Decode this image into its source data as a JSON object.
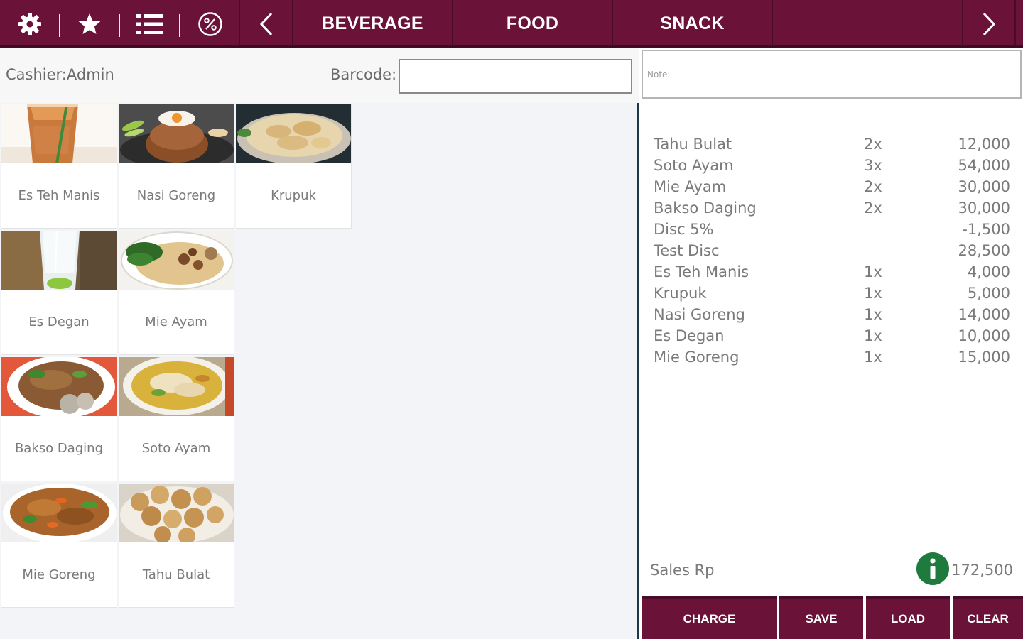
{
  "toolbar": {
    "icons": [
      "gear-icon",
      "star-icon",
      "list-icon",
      "discount-icon",
      "chevron-left-icon",
      "chevron-right-icon"
    ],
    "categories": [
      "BEVERAGE",
      "FOOD",
      "SNACK",
      ""
    ]
  },
  "header": {
    "cashier": "Cashier:Admin",
    "barcode_label": "Barcode:",
    "barcode_value": ""
  },
  "note": {
    "placeholder": "Note:"
  },
  "products": [
    {
      "name": "Es Teh Manis",
      "image": "iced-tea"
    },
    {
      "name": "Nasi Goreng",
      "image": "fried-rice"
    },
    {
      "name": "Krupuk",
      "image": "crackers"
    },
    {
      "name": "Es Degan",
      "image": "coconut-drink"
    },
    {
      "name": "Mie Ayam",
      "image": "chicken-noodle"
    },
    {
      "name": "Bakso Daging",
      "image": "meatball-soup"
    },
    {
      "name": "Soto Ayam",
      "image": "chicken-soup"
    },
    {
      "name": "Mie Goreng",
      "image": "fried-noodle"
    },
    {
      "name": "Tahu Bulat",
      "image": "round-tofu"
    }
  ],
  "order": {
    "items": [
      {
        "name": "Tahu Bulat",
        "qty": "2x",
        "amount": "12,000"
      },
      {
        "name": "Soto Ayam",
        "qty": "3x",
        "amount": "54,000"
      },
      {
        "name": "Mie Ayam",
        "qty": "2x",
        "amount": "30,000"
      },
      {
        "name": "Bakso Daging",
        "qty": "2x",
        "amount": "30,000"
      },
      {
        "name": "Disc 5%",
        "qty": "",
        "amount": "-1,500"
      },
      {
        "name": "Test Disc",
        "qty": "",
        "amount": "28,500"
      },
      {
        "name": "Es Teh Manis",
        "qty": "1x",
        "amount": "4,000"
      },
      {
        "name": "Krupuk",
        "qty": "1x",
        "amount": "5,000"
      },
      {
        "name": "Nasi Goreng",
        "qty": "1x",
        "amount": "14,000"
      },
      {
        "name": "Es Degan",
        "qty": "1x",
        "amount": "10,000"
      },
      {
        "name": "Mie Goreng",
        "qty": "1x",
        "amount": "15,000"
      }
    ],
    "sales_label": "Sales Rp",
    "sales_total": "172,500"
  },
  "actions": {
    "charge": "CHARGE",
    "save": "SAVE",
    "load": "LOAD",
    "clear": "CLEAR"
  },
  "colors": {
    "primary": "#6b1238",
    "info": "#1f7a3d",
    "divider": "#1d3746"
  }
}
